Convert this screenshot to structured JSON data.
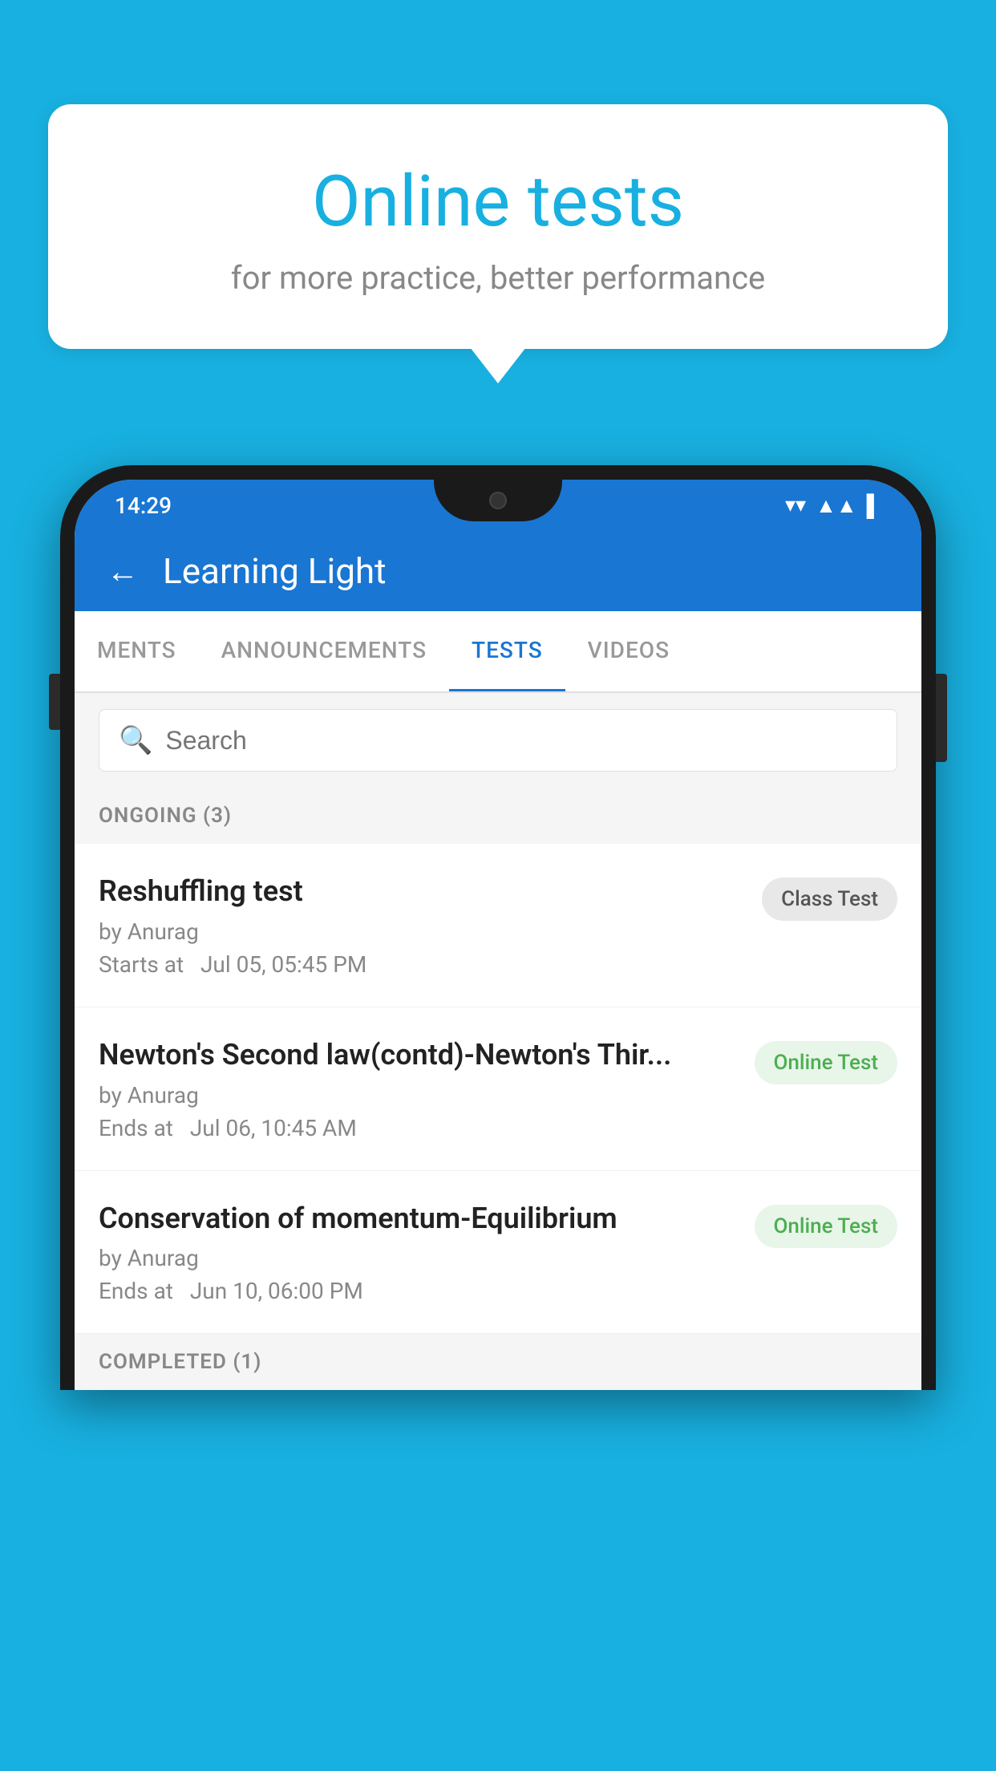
{
  "background_color": "#18b0e0",
  "bubble": {
    "title": "Online tests",
    "subtitle": "for more practice, better performance"
  },
  "phone": {
    "status_bar": {
      "time": "14:29",
      "wifi_icon": "▼",
      "signal_icon": "▲",
      "battery_icon": "▌"
    },
    "header": {
      "back_label": "←",
      "title": "Learning Light"
    },
    "tabs": [
      {
        "label": "MENTS",
        "active": false
      },
      {
        "label": "ANNOUNCEMENTS",
        "active": false
      },
      {
        "label": "TESTS",
        "active": true
      },
      {
        "label": "VIDEOS",
        "active": false
      }
    ],
    "search": {
      "placeholder": "Search",
      "icon": "🔍"
    },
    "ongoing_section": {
      "label": "ONGOING (3)"
    },
    "tests": [
      {
        "name": "Reshuffling test",
        "author": "by Anurag",
        "time_label": "Starts at",
        "time": "Jul 05, 05:45 PM",
        "badge_text": "Class Test",
        "badge_type": "class"
      },
      {
        "name": "Newton's Second law(contd)-Newton's Thir...",
        "author": "by Anurag",
        "time_label": "Ends at",
        "time": "Jul 06, 10:45 AM",
        "badge_text": "Online Test",
        "badge_type": "online"
      },
      {
        "name": "Conservation of momentum-Equilibrium",
        "author": "by Anurag",
        "time_label": "Ends at",
        "time": "Jun 10, 06:00 PM",
        "badge_text": "Online Test",
        "badge_type": "online"
      }
    ],
    "completed_section": {
      "label": "COMPLETED (1)"
    }
  }
}
